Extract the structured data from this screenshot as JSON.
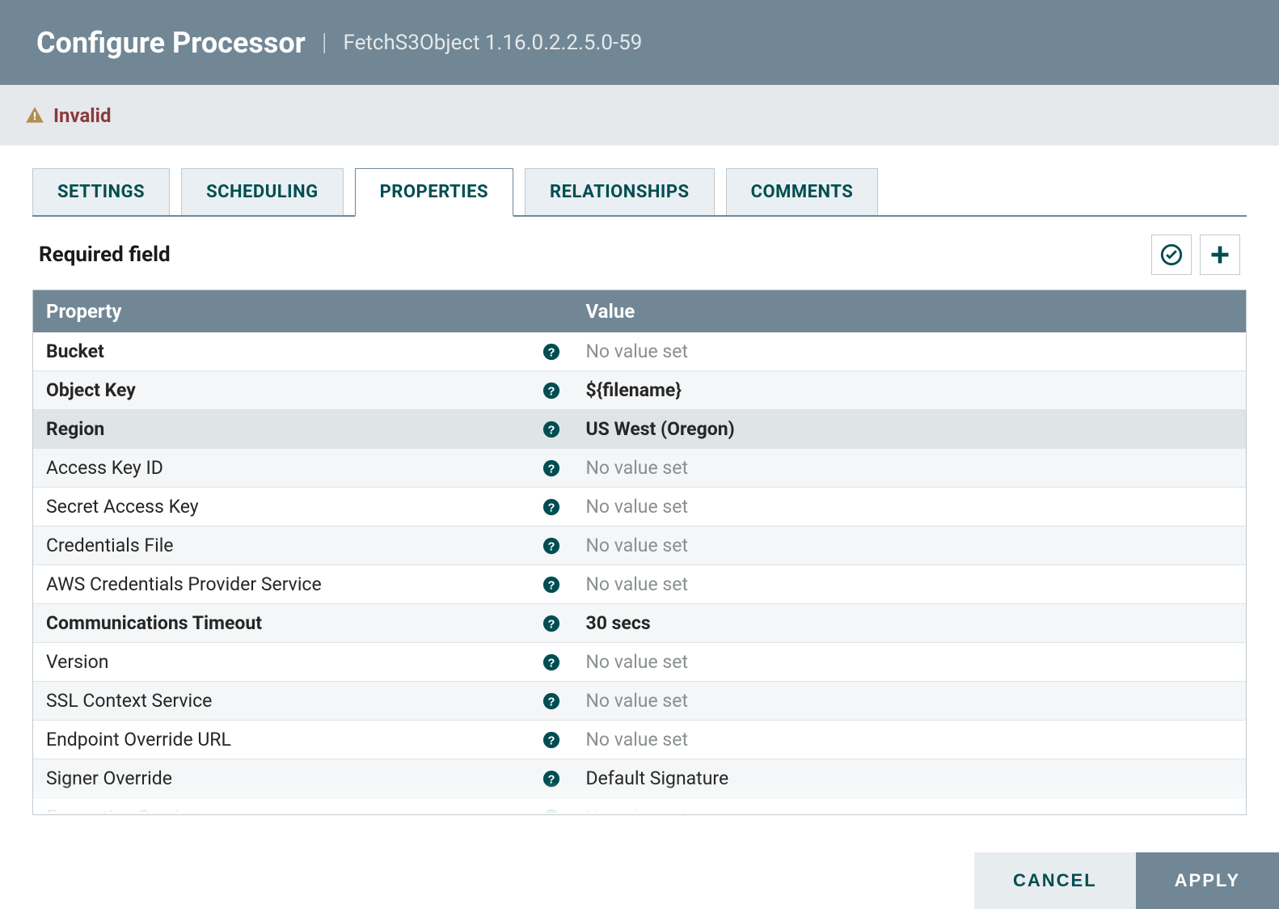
{
  "header": {
    "title": "Configure Processor",
    "subtitle": "FetchS3Object 1.16.0.2.2.5.0-59"
  },
  "status": {
    "text": "Invalid"
  },
  "tabs": [
    {
      "label": "SETTINGS"
    },
    {
      "label": "SCHEDULING"
    },
    {
      "label": "PROPERTIES"
    },
    {
      "label": "RELATIONSHIPS"
    },
    {
      "label": "COMMENTS"
    }
  ],
  "active_tab_index": 2,
  "required_label": "Required field",
  "table": {
    "header_property": "Property",
    "header_value": "Value",
    "rows": [
      {
        "name": "Bucket",
        "value": null,
        "required": true,
        "empty_text": "No value set"
      },
      {
        "name": "Object Key",
        "value": "${filename}",
        "required": true
      },
      {
        "name": "Region",
        "value": "US West (Oregon)",
        "required": true,
        "selected": true
      },
      {
        "name": "Access Key ID",
        "value": null,
        "required": false,
        "empty_text": "No value set"
      },
      {
        "name": "Secret Access Key",
        "value": null,
        "required": false,
        "empty_text": "No value set"
      },
      {
        "name": "Credentials File",
        "value": null,
        "required": false,
        "empty_text": "No value set"
      },
      {
        "name": "AWS Credentials Provider Service",
        "value": null,
        "required": false,
        "empty_text": "No value set"
      },
      {
        "name": "Communications Timeout",
        "value": "30 secs",
        "required": true
      },
      {
        "name": "Version",
        "value": null,
        "required": false,
        "empty_text": "No value set"
      },
      {
        "name": "SSL Context Service",
        "value": null,
        "required": false,
        "empty_text": "No value set"
      },
      {
        "name": "Endpoint Override URL",
        "value": null,
        "required": false,
        "empty_text": "No value set"
      },
      {
        "name": "Signer Override",
        "value": "Default Signature",
        "required": false
      },
      {
        "name": "Encryption Service",
        "value": null,
        "required": false,
        "empty_text": "No value set"
      }
    ]
  },
  "footer": {
    "cancel": "CANCEL",
    "apply": "APPLY"
  }
}
